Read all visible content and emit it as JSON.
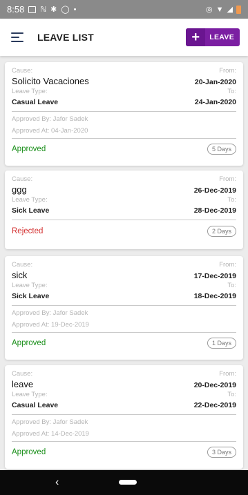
{
  "status_bar": {
    "time": "8:58",
    "left_icons": [
      "notification-icon",
      "n-icon",
      "settings-icon",
      "shield-icon"
    ],
    "right_icons": [
      "vibrate-icon",
      "wifi-icon",
      "signal-icon",
      "battery-icon"
    ],
    "battery_color": "#f1994f"
  },
  "app_bar": {
    "title": "LEAVE LIST",
    "button_label": "LEAVE",
    "button_color": "#7b1fa2"
  },
  "labels": {
    "cause": "Cause:",
    "from": "From:",
    "leave_type": "Leave Type:",
    "to": "To:"
  },
  "leaves": [
    {
      "cause": "Solicito Vacaciones",
      "from": "20-Jan-2020",
      "type": "Casual Leave",
      "to": "24-Jan-2020",
      "approved_by": "Approved By: Jafor Sadek",
      "approved_at": "Approved At: 04-Jan-2020",
      "status": "Approved",
      "days": "5 Days"
    },
    {
      "cause": "ggg",
      "from": "26-Dec-2019",
      "type": "Sick Leave",
      "to": "28-Dec-2019",
      "approved_by": "",
      "approved_at": "",
      "status": "Rejected",
      "days": "2 Days"
    },
    {
      "cause": "sick",
      "from": "17-Dec-2019",
      "type": "Sick Leave",
      "to": "18-Dec-2019",
      "approved_by": "Approved By: Jafor Sadek",
      "approved_at": "Approved At: 19-Dec-2019",
      "status": "Approved",
      "days": "1 Days"
    },
    {
      "cause": "leave",
      "from": "20-Dec-2019",
      "type": "Casual Leave",
      "to": "22-Dec-2019",
      "approved_by": "Approved By: Jafor Sadek",
      "approved_at": "Approved At: 14-Dec-2019",
      "status": "Approved",
      "days": "3 Days"
    }
  ],
  "colors": {
    "approved": "#1a8f1a",
    "rejected": "#d32f2f"
  }
}
